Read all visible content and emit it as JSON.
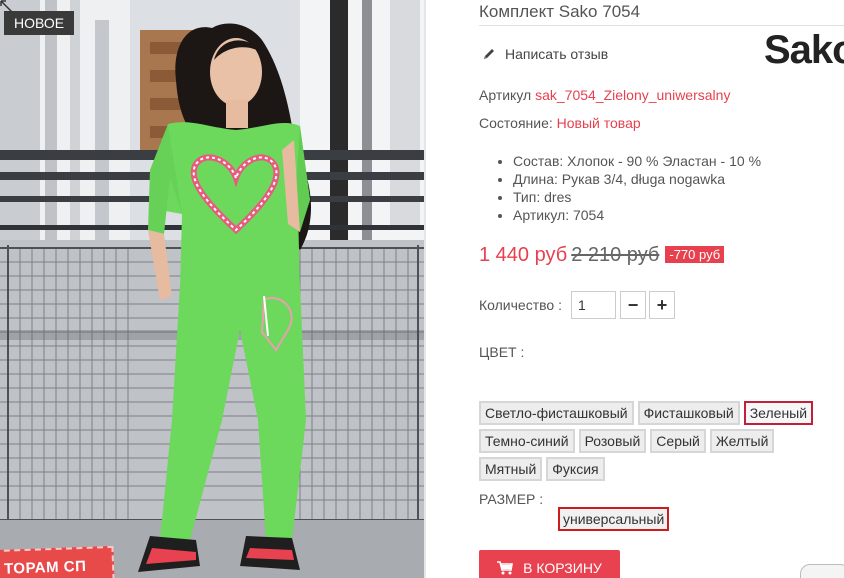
{
  "image": {
    "badge": "НОВОЕ",
    "stamp": "ТОРАМ СП"
  },
  "product": {
    "title": "Комплект Sako 7054",
    "brand": "Sako",
    "review_link": "Написать отзыв",
    "sku_label": "Артикул",
    "sku_value": "sak_7054_Zielony_uniwersalny",
    "condition_label": "Состояние:",
    "condition_value": "Новый товар",
    "features": [
      "Состав: Хлопок - 90 % Эластан - 10 %",
      "Длина: Рукав 3/4, długa nogawka",
      "Тип: dres",
      "Артикул: 7054"
    ]
  },
  "price": {
    "current": "1 440 руб",
    "old": "2 210 руб",
    "discount": "-770 руб"
  },
  "quantity": {
    "label": "Количество :",
    "value": "1",
    "minus": "−",
    "plus": "+"
  },
  "color": {
    "label": "ЦВЕТ :",
    "options": [
      "Светло-фисташковый",
      "Фисташковый",
      "Зеленый",
      "Темно-синий",
      "Розовый",
      "Серый",
      "Желтый",
      "Мятный",
      "Фуксия"
    ],
    "selected": "Зеленый"
  },
  "size": {
    "label": "РАЗМЕР :",
    "option": "универсальный"
  },
  "cart": {
    "label": "В КОРЗИНУ",
    "icon": "cart-icon"
  },
  "colors": {
    "accent": "#e7414f",
    "outfit": "#6cd85c",
    "selected_border": "#c11f3a"
  }
}
